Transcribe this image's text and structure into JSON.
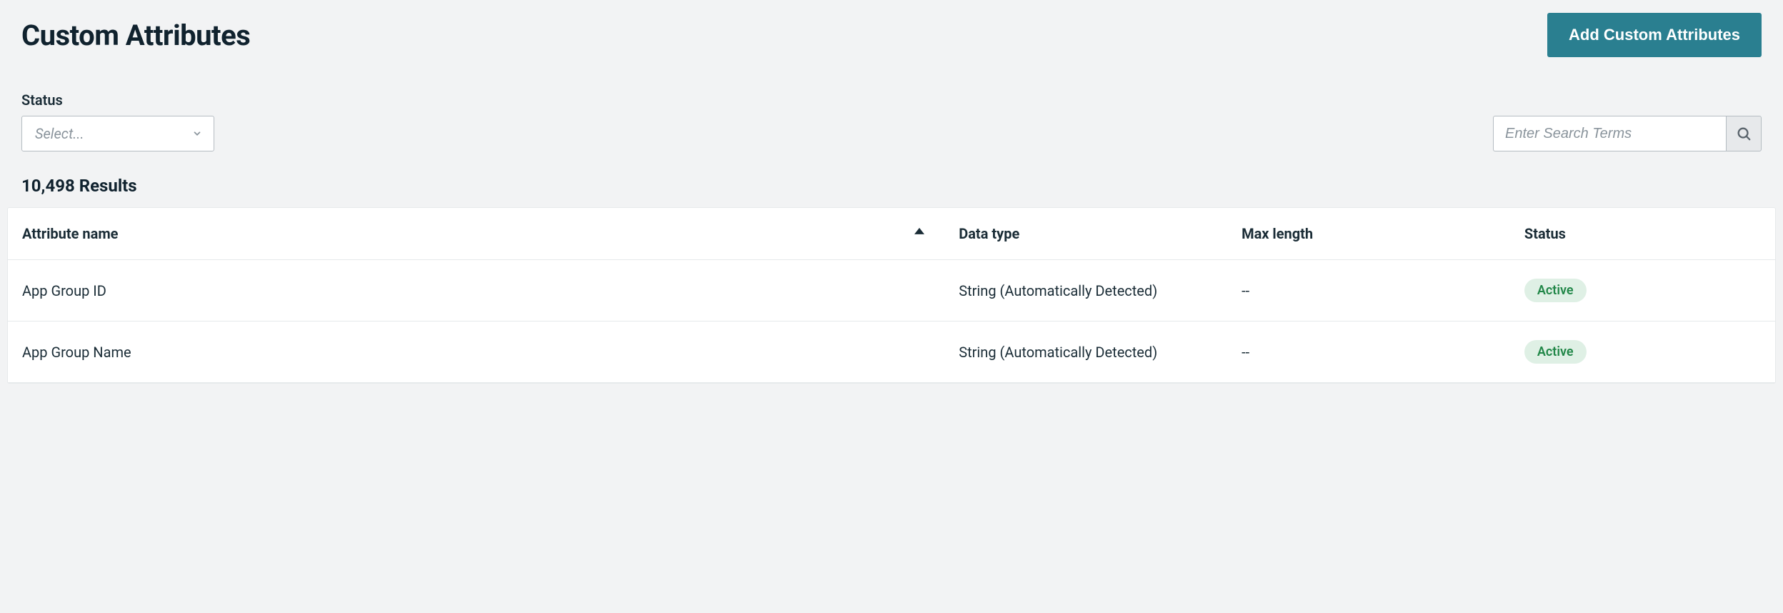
{
  "header": {
    "title": "Custom Attributes",
    "add_button_label": "Add Custom Attributes"
  },
  "filters": {
    "status_label": "Status",
    "status_placeholder": "Select...",
    "search_placeholder": "Enter Search Terms"
  },
  "results": {
    "count_text": "10,498 Results"
  },
  "table": {
    "columns": {
      "name": "Attribute name",
      "type": "Data type",
      "max_length": "Max length",
      "status": "Status"
    },
    "rows": [
      {
        "name": "App Group ID",
        "type": "String (Automatically Detected)",
        "max_length": "--",
        "status": "Active"
      },
      {
        "name": "App Group Name",
        "type": "String (Automatically Detected)",
        "max_length": "--",
        "status": "Active"
      }
    ]
  }
}
